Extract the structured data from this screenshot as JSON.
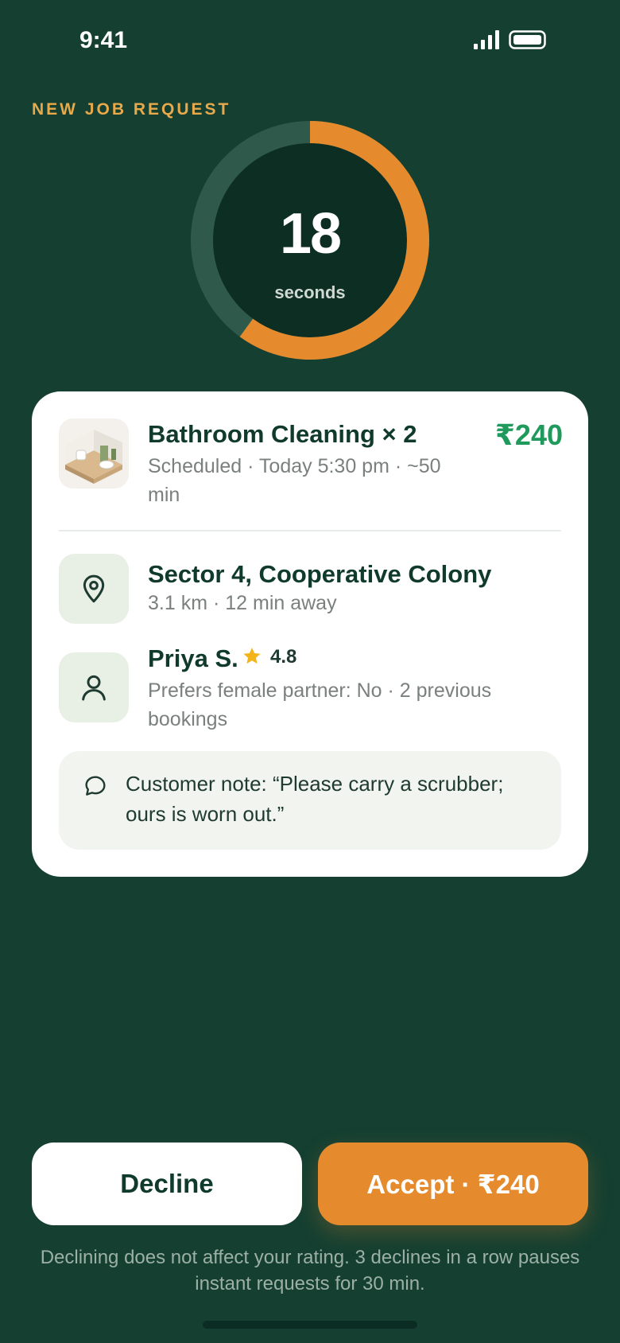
{
  "status_bar": {
    "time": "9:41"
  },
  "header": {
    "eyebrow": "NEW JOB REQUEST"
  },
  "timer": {
    "value": "18",
    "unit": "seconds",
    "remaining_fraction": 0.6
  },
  "job": {
    "title": "Bathroom Cleaning × 2",
    "price": "₹240",
    "meta": "Scheduled · Today 5:30 pm · ~50 min",
    "location_title": "Sector 4, Cooperative Colony",
    "location_meta": "3.1 km · 12 min away",
    "customer_name": "Priya S.",
    "customer_rating": "4.8",
    "customer_meta": "Prefers female partner: No · 2 previous bookings",
    "note": "Customer note: “Please carry a scrubber; ours is worn out.”"
  },
  "actions": {
    "decline_label": "Decline",
    "accept_label": "Accept · ₹240"
  },
  "footnote": "Declining does not affect your rating. 3 declines in a row pauses instant requests for 30 min.",
  "colors": {
    "background": "#143f31",
    "accent": "#e68a2e",
    "price": "#1f9a5c",
    "eyebrow": "#e8a94a"
  },
  "icons": [
    "signal-icon",
    "battery-icon",
    "location-pin-icon",
    "user-icon",
    "star-icon",
    "chat-bubble-icon"
  ]
}
